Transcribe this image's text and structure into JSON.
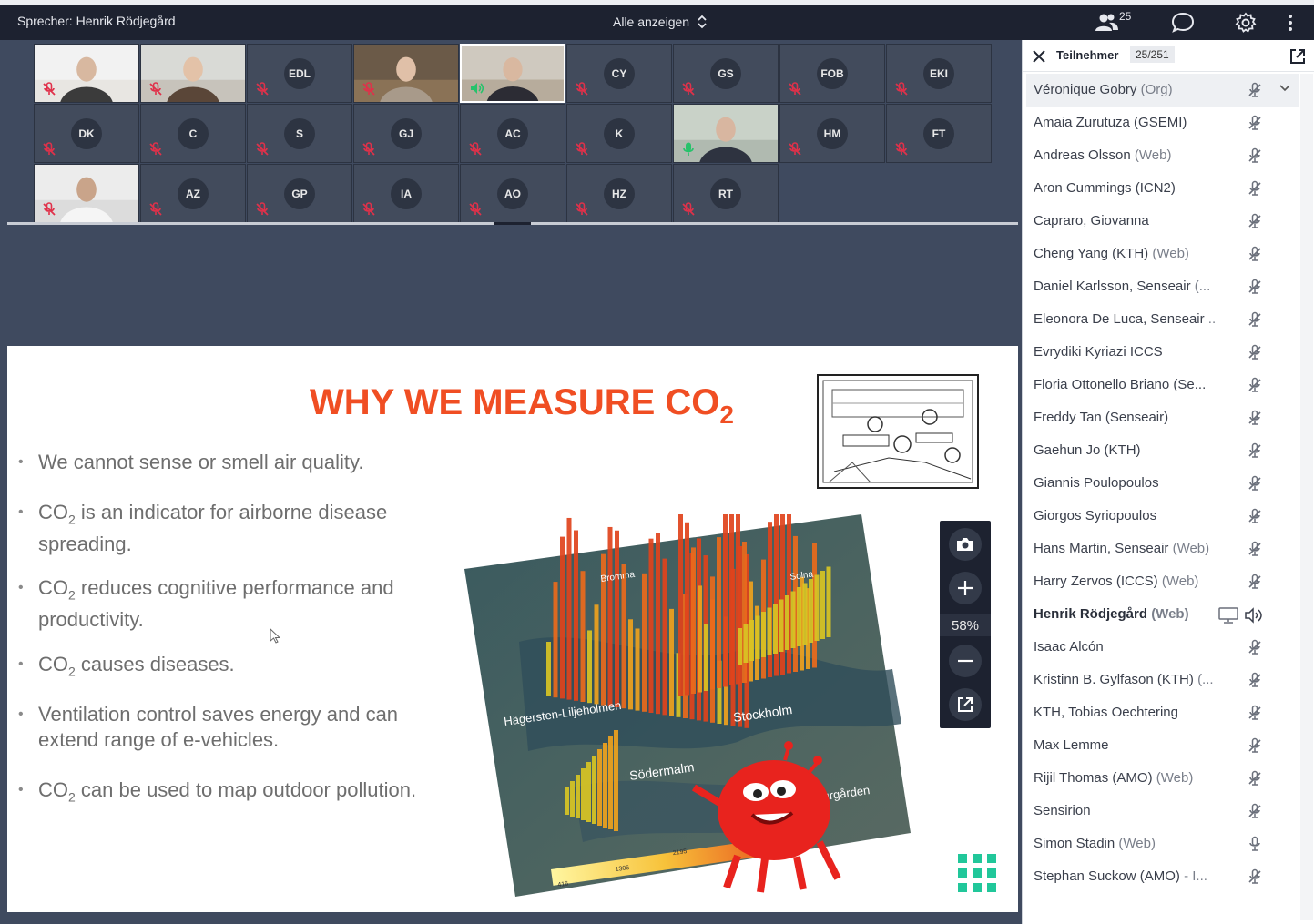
{
  "topbar": {
    "speaker": "Sprecher: Henrik Rödjegård",
    "show_all": "Alle anzeigen",
    "participant_count_badge": "25"
  },
  "video_tiles": [
    {
      "initials": "",
      "has_video": true,
      "mic": "muted",
      "photo": "headset-man"
    },
    {
      "initials": "",
      "has_video": true,
      "mic": "muted",
      "photo": "woman"
    },
    {
      "initials": "EDL",
      "has_video": false,
      "mic": "muted"
    },
    {
      "initials": "",
      "has_video": true,
      "mic": "muted",
      "photo": "bookshelf-man"
    },
    {
      "initials": "",
      "has_video": true,
      "mic": "speaking",
      "photo": "man-room",
      "active": true
    },
    {
      "initials": "CY",
      "has_video": false,
      "mic": "muted"
    },
    {
      "initials": "GS",
      "has_video": false,
      "mic": "muted"
    },
    {
      "initials": "FOB",
      "has_video": false,
      "mic": "muted"
    },
    {
      "initials": "EKI",
      "has_video": false,
      "mic": "muted"
    },
    {
      "initials": "DK",
      "has_video": false,
      "mic": "muted"
    },
    {
      "initials": "C",
      "has_video": false,
      "mic": "muted"
    },
    {
      "initials": "S",
      "has_video": false,
      "mic": "muted"
    },
    {
      "initials": "GJ",
      "has_video": false,
      "mic": "muted"
    },
    {
      "initials": "AC",
      "has_video": false,
      "mic": "muted"
    },
    {
      "initials": "K",
      "has_video": false,
      "mic": "muted"
    },
    {
      "initials": "",
      "has_video": true,
      "mic": "open",
      "photo": "man-window"
    },
    {
      "initials": "HM",
      "has_video": false,
      "mic": "muted"
    },
    {
      "initials": "FT",
      "has_video": false,
      "mic": "muted"
    },
    {
      "initials": "",
      "has_video": true,
      "mic": "muted",
      "photo": "headset-man-2"
    },
    {
      "initials": "AZ",
      "has_video": false,
      "mic": "muted"
    },
    {
      "initials": "GP",
      "has_video": false,
      "mic": "muted"
    },
    {
      "initials": "IA",
      "has_video": false,
      "mic": "muted"
    },
    {
      "initials": "AO",
      "has_video": false,
      "mic": "muted"
    },
    {
      "initials": "HZ",
      "has_video": false,
      "mic": "muted"
    },
    {
      "initials": "RT",
      "has_video": false,
      "mic": "muted"
    }
  ],
  "slide": {
    "title": "WHY WE MEASURE CO",
    "title_sub": "2",
    "bullets": [
      {
        "pre": "We cannot sense or smell air quality.",
        "sub": "",
        "post": ""
      },
      {
        "pre": "CO",
        "sub": "2",
        "post": " is an indicator for airborne disease spreading."
      },
      {
        "pre": "CO",
        "sub": "2",
        "post": " reduces cognitive performance and productivity."
      },
      {
        "pre": "CO",
        "sub": "2",
        "post": " causes diseases."
      },
      {
        "pre": "Ventilation control saves energy and can extend range of e-vehicles.",
        "sub": "",
        "post": ""
      },
      {
        "pre": "CO",
        "sub": "2",
        "post": " can be used to map outdoor pollution."
      }
    ],
    "map_labels": {
      "bromma": "Bromma",
      "solna": "Solna",
      "hagersten": "Hägersten-Liljeholmen",
      "stockholm": "Stockholm",
      "sodermalm": "Södermalm",
      "djurgarden": "Djurgården",
      "scale_1": "416",
      "scale_2": "1306",
      "scale_3": "2195"
    }
  },
  "zoom": {
    "percent": "58%"
  },
  "panel": {
    "title": "Teilnehmer",
    "count": "25/251",
    "participants": [
      {
        "name": "Véronique Gobry",
        "tag": "(Org)",
        "mic": "muted",
        "selected": true
      },
      {
        "name": "Amaia Zurutuza (GSEMI)",
        "tag": "",
        "mic": "muted"
      },
      {
        "name": "Andreas Olsson",
        "tag": "(Web)",
        "mic": "muted"
      },
      {
        "name": "Aron Cummings (ICN2)",
        "tag": "",
        "mic": "muted"
      },
      {
        "name": "Capraro, Giovanna",
        "tag": "",
        "mic": "muted"
      },
      {
        "name": "Cheng Yang (KTH)",
        "tag": "(Web)",
        "mic": "muted"
      },
      {
        "name": "Daniel Karlsson, Senseair",
        "tag": "(...",
        "mic": "muted"
      },
      {
        "name": "Eleonora De Luca, Senseair",
        "tag": "..",
        "mic": "muted"
      },
      {
        "name": "Evrydiki Kyriazi ICCS",
        "tag": "",
        "mic": "muted"
      },
      {
        "name": "Floria Ottonello Briano (Se...",
        "tag": "",
        "mic": "muted"
      },
      {
        "name": "Freddy Tan (Senseair)",
        "tag": "",
        "mic": "muted"
      },
      {
        "name": "Gaehun Jo (KTH)",
        "tag": "",
        "mic": "muted"
      },
      {
        "name": "Giannis Poulopoulos",
        "tag": "",
        "mic": "muted"
      },
      {
        "name": "Giorgos Syriopoulos",
        "tag": "",
        "mic": "muted"
      },
      {
        "name": "Hans Martin, Senseair",
        "tag": "(Web)",
        "mic": "muted"
      },
      {
        "name": "Harry Zervos (ICCS)",
        "tag": "(Web)",
        "mic": "muted"
      },
      {
        "name": "Henrik Rödjegård",
        "tag": "(Web)",
        "mic": "presenting",
        "bold": true
      },
      {
        "name": "Isaac Alcón",
        "tag": "",
        "mic": "muted"
      },
      {
        "name": "Kristinn B. Gylfason (KTH)",
        "tag": "(...",
        "mic": "muted"
      },
      {
        "name": "KTH, Tobias Oechtering",
        "tag": "",
        "mic": "muted"
      },
      {
        "name": "Max Lemme",
        "tag": "",
        "mic": "muted"
      },
      {
        "name": "Rijil Thomas (AMO)",
        "tag": "(Web)",
        "mic": "muted"
      },
      {
        "name": "Sensirion",
        "tag": "",
        "mic": "muted"
      },
      {
        "name": "Simon Stadin",
        "tag": "(Web)",
        "mic": "open"
      },
      {
        "name": "Stephan Suckow (AMO)",
        "tag": "- I...",
        "mic": "muted"
      }
    ]
  },
  "colors": {
    "accent_red": "#f04e23",
    "speaking_green": "#27c26b",
    "muted_red": "#e0314a",
    "logo_green": "#21c79a"
  }
}
